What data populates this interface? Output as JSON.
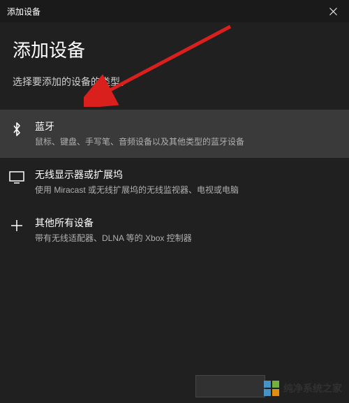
{
  "titlebar": {
    "text": "添加设备"
  },
  "heading": "添加设备",
  "subheading": "选择要添加的设备的类型。",
  "options": [
    {
      "title": "蓝牙",
      "desc": "鼠标、键盘、手写笔、音频设备以及其他类型的蓝牙设备"
    },
    {
      "title": "无线显示器或扩展坞",
      "desc": "使用 Miracast 或无线扩展坞的无线监视器、电视或电脑"
    },
    {
      "title": "其他所有设备",
      "desc": "带有无线适配器、DLNA 等的 Xbox 控制器"
    }
  ],
  "watermark": {
    "text": "纯净系统之家",
    "url": "www.jzy.com"
  }
}
